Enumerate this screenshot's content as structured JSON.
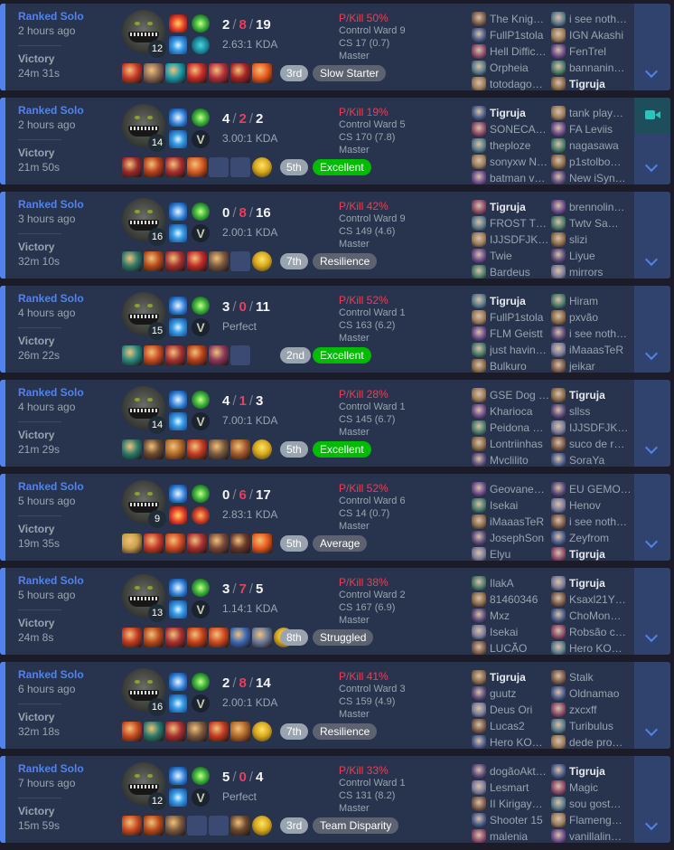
{
  "colors": {
    "win": "#5383e8",
    "deaths": "#e84057",
    "excellent": "#00bb00",
    "neutral_badge": "#5c6270",
    "place_bg": "#9aa4af",
    "empty_slot": "#3a4a72"
  },
  "me": "Tigruja",
  "matches": [
    {
      "queue": "Ranked Solo",
      "ago": "2 hours ago",
      "result": "Victory",
      "duration": "24m 31s",
      "level": "12",
      "spells": [
        "ignite-spell-icon",
        "flash-spell-icon"
      ],
      "runes": [
        "green-rune-icon",
        "teal-rune-icon"
      ],
      "kills": "2",
      "deaths": "8",
      "assists": "19",
      "ratio": "2.63:1 KDA",
      "items": [
        "#c83a28",
        "#8a6a55",
        "#1a9aaa",
        "#c82a2a",
        "#b3303a",
        "#a92525",
        "#e85a1f"
      ],
      "ward_item": false,
      "place": "3rd",
      "badge": "Slow Starter",
      "badge_color": "#5c6270",
      "pkill": "P/Kill 50%",
      "control_ward": "Control Ward 9",
      "cs": "CS 17 (0.7)",
      "tier": "Master",
      "team1": [
        "The Knig…",
        "FullP1stola",
        "Hell Diffic…",
        "Orpheia",
        "totodago…"
      ],
      "team2": [
        "i see noth…",
        "IGN Akashi",
        "FenTrel",
        "bannanin…",
        "Tigruja"
      ],
      "video": false
    },
    {
      "queue": "Ranked Solo",
      "ago": "2 hours ago",
      "result": "Victory",
      "duration": "21m 50s",
      "level": "14",
      "spells": [
        "ghost-spell-icon",
        "flash-spell-icon"
      ],
      "runes": [
        "green-rune-icon",
        "v-rune-icon"
      ],
      "kills": "4",
      "deaths": "2",
      "assists": "2",
      "ratio": "3.00:1 KDA",
      "items": [
        "#9a2a2a",
        "#b8401a",
        "#a82e2e",
        "#d45a22",
        "empty",
        "empty"
      ],
      "ward_item": true,
      "place": "5th",
      "badge": "Excellent",
      "badge_color": "#00bb00",
      "pkill": "P/Kill 19%",
      "control_ward": "Control Ward 5",
      "cs": "CS 170 (7.8)",
      "tier": "Master",
      "team1": [
        "Tigruja",
        "SONECA…",
        "theploze",
        "sonyxw N…",
        "batman v…"
      ],
      "team2": [
        "tank play…",
        "FA Leviis",
        "nagasawa",
        "p1stolbo…",
        "New iSyn…"
      ],
      "video": true
    },
    {
      "queue": "Ranked Solo",
      "ago": "3 hours ago",
      "result": "Victory",
      "duration": "32m 10s",
      "level": "16",
      "spells": [
        "ghost-spell-icon",
        "flash-spell-icon"
      ],
      "runes": [
        "green-rune-icon",
        "v-rune-icon"
      ],
      "kills": "0",
      "deaths": "8",
      "assists": "16",
      "ratio": "2.00:1 KDA",
      "items": [
        "#2e7a6a",
        "#b84a1a",
        "#a63030",
        "#c02a2a",
        "#7a5a40",
        "empty"
      ],
      "ward_item": true,
      "place": "7th",
      "badge": "Resilience",
      "badge_color": "#5c6270",
      "pkill": "P/Kill 42%",
      "control_ward": "Control Ward 9",
      "cs": "CS 149 (4.6)",
      "tier": "Master",
      "team1": [
        "Tigruja",
        "FROST T…",
        "IJJSDFJK…",
        "Twie",
        "Bardeus"
      ],
      "team2": [
        "brennolin…",
        "Twtv Sa…",
        "slizi",
        "Liyue",
        "mirrors"
      ],
      "video": false
    },
    {
      "queue": "Ranked Solo",
      "ago": "4 hours ago",
      "result": "Victory",
      "duration": "26m 22s",
      "level": "15",
      "spells": [
        "ghost-spell-icon",
        "flash-spell-icon"
      ],
      "runes": [
        "green-rune-icon",
        "v-rune-icon"
      ],
      "kills": "3",
      "deaths": "0",
      "assists": "11",
      "ratio": "Perfect",
      "items": [
        "#2a8a80",
        "#c84a22",
        "#a83232",
        "#b8401a",
        "#8a3a5a",
        "empty"
      ],
      "ward_item": false,
      "place": "2nd",
      "badge": "Excellent",
      "badge_color": "#00bb00",
      "pkill": "P/Kill 52%",
      "control_ward": "Control Ward 1",
      "cs": "CS 163 (6.2)",
      "tier": "Master",
      "team1": [
        "Tigruja",
        "FullP1stola",
        "FLM Geistt",
        "just havin…",
        "Bulkuro"
      ],
      "team2": [
        "Hiram",
        "pxvão",
        "i see noth…",
        "iMaaasTeR",
        "jeikar"
      ],
      "video": false
    },
    {
      "queue": "Ranked Solo",
      "ago": "4 hours ago",
      "result": "Victory",
      "duration": "21m 29s",
      "level": "14",
      "spells": [
        "ghost-spell-icon",
        "flash-spell-icon"
      ],
      "runes": [
        "green-rune-icon",
        "v-rune-icon"
      ],
      "kills": "4",
      "deaths": "1",
      "assists": "3",
      "ratio": "7.00:1 KDA",
      "items": [
        "#2a7a6a",
        "#6a4a30",
        "#b06a2a",
        "#c23a22",
        "#7a5a40",
        "#a05a2a"
      ],
      "ward_item": true,
      "place": "5th",
      "badge": "Excellent",
      "badge_color": "#00bb00",
      "pkill": "P/Kill 28%",
      "control_ward": "Control Ward 1",
      "cs": "CS 145 (6.7)",
      "tier": "Master",
      "team1": [
        "GSE Dog …",
        "Kharioca",
        "Peidona …",
        "Lontriinhas",
        "Mvclilito"
      ],
      "team2": [
        "Tigruja",
        "sllss",
        "IJJSDFJK…",
        "suco de r…",
        "SoraYa"
      ],
      "video": false
    },
    {
      "queue": "Ranked Solo",
      "ago": "5 hours ago",
      "result": "Victory",
      "duration": "19m 35s",
      "level": "9",
      "spells": [
        "ghost-spell-icon",
        "ignite-spell-icon"
      ],
      "runes": [
        "green-rune-icon",
        "red-rune-icon"
      ],
      "kills": "0",
      "deaths": "6",
      "assists": "17",
      "ratio": "2.83:1 KDA",
      "items": [
        "#c8a04a",
        "#c83a2a",
        "#d04a22",
        "#a83030",
        "#7a4a3a",
        "#6a3a2a",
        "#e85a1f"
      ],
      "ward_item": false,
      "place": "5th",
      "badge": "Average",
      "badge_color": "#5c6270",
      "pkill": "P/Kill 52%",
      "control_ward": "Control Ward 6",
      "cs": "CS 14 (0.7)",
      "tier": "Master",
      "team1": [
        "Geovane…",
        "Isekai",
        "iMaaasTeR",
        "JosephSon",
        "Elyu"
      ],
      "team2": [
        "EU GEMO…",
        "Henov",
        "i see noth…",
        "Zeyfrom",
        "Tigruja"
      ],
      "video": false
    },
    {
      "queue": "Ranked Solo",
      "ago": "5 hours ago",
      "result": "Victory",
      "duration": "24m 8s",
      "level": "13",
      "spells": [
        "ghost-spell-icon",
        "flash-spell-icon"
      ],
      "runes": [
        "green-rune-icon",
        "v-rune-icon"
      ],
      "kills": "3",
      "deaths": "7",
      "assists": "5",
      "ratio": "1.14:1 KDA",
      "items": [
        "#c23a22",
        "#b84a1a",
        "#a83030",
        "#c8401a",
        "#d04a22",
        "#3a6ab8",
        "#6a7a9a"
      ],
      "ward_item": true,
      "place": "8th",
      "badge": "Struggled",
      "badge_color": "#5c6270",
      "pkill": "P/Kill 38%",
      "control_ward": "Control Ward 2",
      "cs": "CS 167 (6.9)",
      "tier": "Master",
      "team1": [
        "IlakA",
        "81460346",
        "Mxz",
        "Isekai",
        "LUCÃO"
      ],
      "team2": [
        "Tigruja",
        "Ksaxl21Y…",
        "ChoMon…",
        "Robsão c…",
        "Hero KO…"
      ],
      "video": false
    },
    {
      "queue": "Ranked Solo",
      "ago": "6 hours ago",
      "result": "Victory",
      "duration": "32m 18s",
      "level": "16",
      "spells": [
        "ghost-spell-icon",
        "flash-spell-icon"
      ],
      "runes": [
        "green-rune-icon",
        "v-rune-icon"
      ],
      "kills": "2",
      "deaths": "8",
      "assists": "14",
      "ratio": "2.00:1 KDA",
      "items": [
        "#c84a22",
        "#2a7a6a",
        "#a83030",
        "#7a5a40",
        "#c23a22",
        "#b06a2a"
      ],
      "ward_item": true,
      "place": "7th",
      "badge": "Resilience",
      "badge_color": "#5c6270",
      "pkill": "P/Kill 41%",
      "control_ward": "Control Ward 3",
      "cs": "CS 159 (4.9)",
      "tier": "Master",
      "team1": [
        "Tigruja",
        "guutz",
        "Deus Ori",
        "Lucas2",
        "Hero KO…"
      ],
      "team2": [
        "Stalk",
        "Oldnamao",
        "zxcxff",
        "Turibulus",
        "dede pro…"
      ],
      "video": false
    },
    {
      "queue": "Ranked Solo",
      "ago": "7 hours ago",
      "result": "Victory",
      "duration": "15m 59s",
      "level": "12",
      "spells": [
        "ghost-spell-icon",
        "flash-spell-icon"
      ],
      "runes": [
        "green-rune-icon",
        "v-rune-icon"
      ],
      "kills": "5",
      "deaths": "0",
      "assists": "4",
      "ratio": "Perfect",
      "items": [
        "#c84a22",
        "#b84a1a",
        "#7a5a40",
        "empty",
        "empty",
        "#6a4a30"
      ],
      "ward_item": true,
      "place": "3rd",
      "badge": "Team Disparity",
      "badge_color": "#5c6270",
      "pkill": "P/Kill 33%",
      "control_ward": "Control Ward 1",
      "cs": "CS 131 (8.2)",
      "tier": "Master",
      "team1": [
        "dogãoAkt…",
        "Lesmart",
        "II Kirigay…",
        "Shooter 15",
        "malenia"
      ],
      "team2": [
        "Tigruja",
        "Magic",
        "sou gost…",
        "Flameng…",
        "vanillalin…"
      ],
      "video": false
    }
  ]
}
